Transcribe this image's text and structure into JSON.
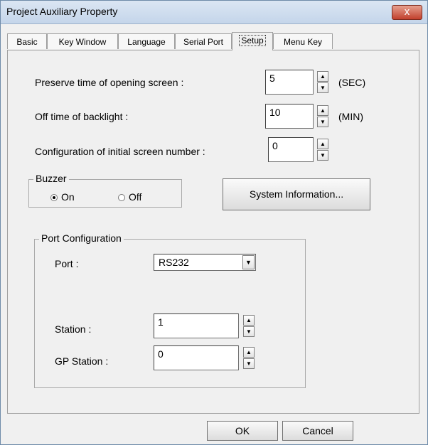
{
  "window": {
    "title": "Project Auxiliary Property",
    "close_label": "x"
  },
  "tabs": [
    {
      "label": "Basic"
    },
    {
      "label": "Key Window"
    },
    {
      "label": "Language"
    },
    {
      "label": "Serial Port"
    },
    {
      "label": "Setup",
      "active": true
    },
    {
      "label": "Menu Key"
    }
  ],
  "setup": {
    "preserve": {
      "label": "Preserve time of opening screen  :",
      "value": "5",
      "unit": "(SEC)"
    },
    "backlight": {
      "label": "Off time of backlight  :",
      "value": "10",
      "unit": "(MIN)"
    },
    "initial_screen": {
      "label": "Configuration of initial screen number  :",
      "value": "0"
    },
    "buzzer": {
      "title": "Buzzer",
      "on_label": "On",
      "off_label": "Off",
      "selected": "On"
    },
    "system_info_button": "System Information...",
    "port_config": {
      "title": "Port Configuration",
      "port_label": "Port :",
      "port_value": "RS232",
      "station_label": "Station :",
      "station_value": "1",
      "gp_station_label": "GP Station :",
      "gp_station_value": "0"
    }
  },
  "footer": {
    "ok": "OK",
    "cancel": "Cancel"
  },
  "icons": {
    "up": "▲",
    "down": "▼",
    "dropdown": "▼"
  }
}
